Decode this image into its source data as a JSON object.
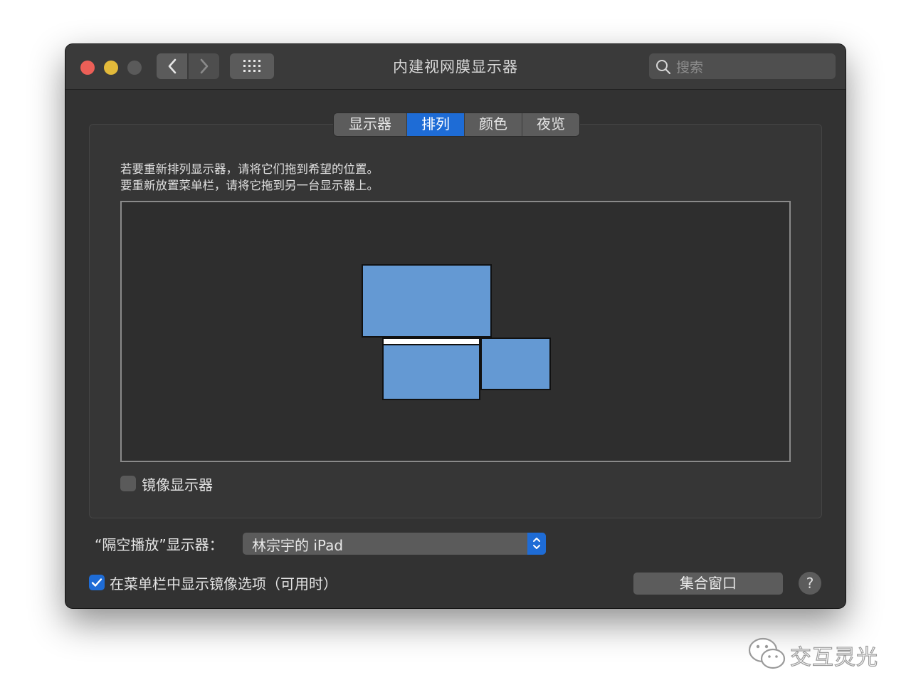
{
  "window": {
    "title": "内建视网膜显示器",
    "search_placeholder": "搜索"
  },
  "tabs": [
    {
      "label": "显示器",
      "active": false
    },
    {
      "label": "排列",
      "active": true
    },
    {
      "label": "颜色",
      "active": false
    },
    {
      "label": "夜览",
      "active": false
    }
  ],
  "arrangement": {
    "instruction_line1": "若要重新排列显示器，请将它们拖到希望的位置。",
    "instruction_line2": "要重新放置菜单栏，请将它拖到另一台显示器上。"
  },
  "mirror": {
    "label": "镜像显示器",
    "checked": false
  },
  "airplay": {
    "label": "“隔空播放”显示器：",
    "selected": "林宗宇的 iPad"
  },
  "menu_option": {
    "label": "在菜单栏中显示镜像选项（可用时）",
    "checked": true
  },
  "buttons": {
    "gather": "集合窗口",
    "help": "?"
  },
  "watermark": {
    "text": "交互灵光"
  },
  "colors": {
    "accent": "#1e6cd6",
    "display_fill": "#6499d3",
    "window_bg": "#323232"
  }
}
